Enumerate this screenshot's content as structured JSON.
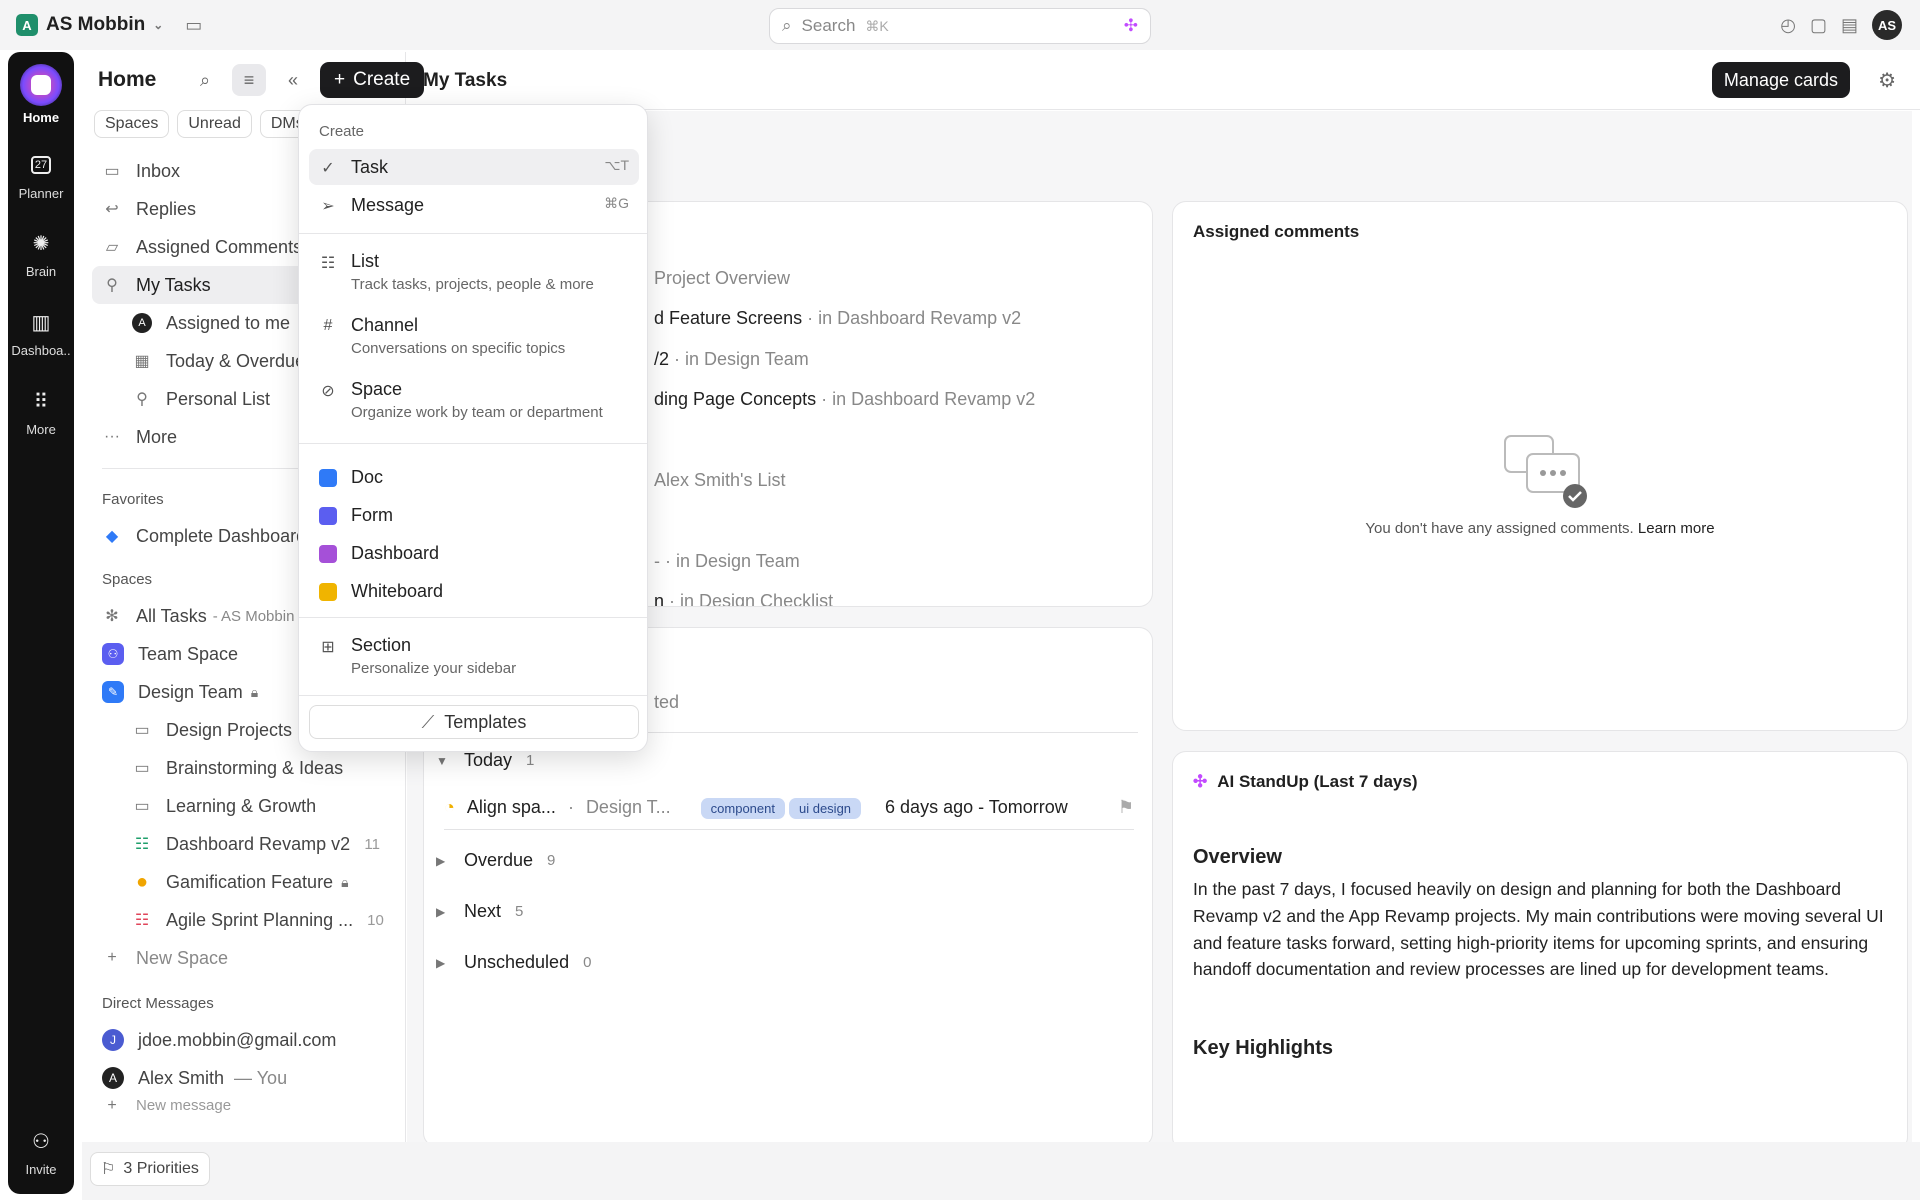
{
  "topbar": {
    "workspace_initial": "A",
    "workspace_name": "AS Mobbin",
    "search_placeholder": "Search",
    "search_shortcut": "⌘K",
    "user_initials": "AS"
  },
  "rail": {
    "items": [
      {
        "label": "Home"
      },
      {
        "label": "Planner",
        "badge": "27"
      },
      {
        "label": "Brain"
      },
      {
        "label": "Dashboa.."
      },
      {
        "label": "More"
      }
    ],
    "invite_label": "Invite"
  },
  "sidebar": {
    "title": "Home",
    "create_label": "Create",
    "chips": [
      "Spaces",
      "Unread",
      "DMs"
    ],
    "nav": [
      {
        "label": "Inbox"
      },
      {
        "label": "Replies"
      },
      {
        "label": "Assigned Comments"
      },
      {
        "label": "My Tasks"
      },
      {
        "label": "Assigned to me"
      },
      {
        "label": "Today & Overdue"
      },
      {
        "label": "Personal List"
      },
      {
        "label": "More"
      }
    ],
    "favorites_label": "Favorites",
    "favorites": [
      {
        "label": "Complete Dashboard"
      }
    ],
    "spaces_label": "Spaces",
    "spaces": [
      {
        "label": "All Tasks",
        "suffix": "- AS Mobbin"
      },
      {
        "label": "Team Space"
      },
      {
        "label": "Design Team"
      },
      {
        "label": "Design Projects"
      },
      {
        "label": "Brainstorming & Ideas"
      },
      {
        "label": "Learning & Growth"
      },
      {
        "label": "Dashboard Revamp v2",
        "count": "11"
      },
      {
        "label": "Gamification Feature"
      },
      {
        "label": "Agile Sprint Planning ...",
        "count": "10"
      },
      {
        "label": "New Space"
      }
    ],
    "dm_label": "Direct Messages",
    "dms": [
      {
        "initial": "J",
        "label": "jdoe.mobbin@gmail.com"
      },
      {
        "initial": "A",
        "label": "Alex Smith",
        "suffix": "— You"
      }
    ],
    "new_message": "New message"
  },
  "main": {
    "title": "My Tasks",
    "manage_cards": "Manage cards",
    "recents": [
      {
        "name": "",
        "loc": "Project Overview"
      },
      {
        "name": "d Feature Screens",
        "loc": "in Dashboard Revamp v2"
      },
      {
        "name": "/2",
        "loc": "in Design Team"
      },
      {
        "name": "ding Page Concepts",
        "loc": "in Dashboard Revamp v2"
      },
      {
        "name": "",
        "loc": "Alex Smith's List"
      },
      {
        "name": "",
        "loc": "in Design Team"
      },
      {
        "name": "n",
        "loc": "in Design Checklist"
      }
    ],
    "work_tab_fragment": "ted",
    "groups": {
      "today": {
        "label": "Today",
        "count": "1"
      },
      "overdue": {
        "label": "Overdue",
        "count": "9"
      },
      "next": {
        "label": "Next",
        "count": "5"
      },
      "unscheduled": {
        "label": "Unscheduled",
        "count": "0"
      }
    },
    "today_task": {
      "name": "Align spa...",
      "loc": "Design T...",
      "tags": [
        "component",
        "ui design"
      ],
      "dates": "6 days ago - Tomorrow"
    },
    "assigned_comments": {
      "title": "Assigned comments",
      "empty": "You don't have any assigned comments.",
      "learn_more": "Learn more"
    },
    "standup": {
      "title": "AI StandUp (Last 7 days)",
      "overview_heading": "Overview",
      "overview_text": "In the past 7 days, I focused heavily on design and planning for both the Dashboard Revamp v2 and the App Revamp projects. My main contributions were moving several UI and feature tasks forward, setting high-priority items for upcoming sprints, and ensuring handoff documentation and review processes are lined up for development teams.",
      "highlights_heading": "Key Highlights"
    }
  },
  "create_menu": {
    "label": "Create",
    "task": {
      "label": "Task",
      "shortcut": "⌥T"
    },
    "message": {
      "label": "Message",
      "shortcut": "⌘G"
    },
    "list": {
      "label": "List",
      "desc": "Track tasks, projects, people & more"
    },
    "channel": {
      "label": "Channel",
      "desc": "Conversations on specific topics"
    },
    "space": {
      "label": "Space",
      "desc": "Organize work by team or department"
    },
    "doc": {
      "label": "Doc"
    },
    "form": {
      "label": "Form"
    },
    "dashboard": {
      "label": "Dashboard"
    },
    "whiteboard": {
      "label": "Whiteboard"
    },
    "section": {
      "label": "Section",
      "desc": "Personalize your sidebar"
    },
    "templates": "Templates"
  },
  "bottombar": {
    "priorities": "3 Priorities"
  },
  "colors": {
    "accent_dark": "#1c1c1e",
    "workspace_green": "#1f8f6b",
    "tag_blue": "#c9d8f5"
  }
}
